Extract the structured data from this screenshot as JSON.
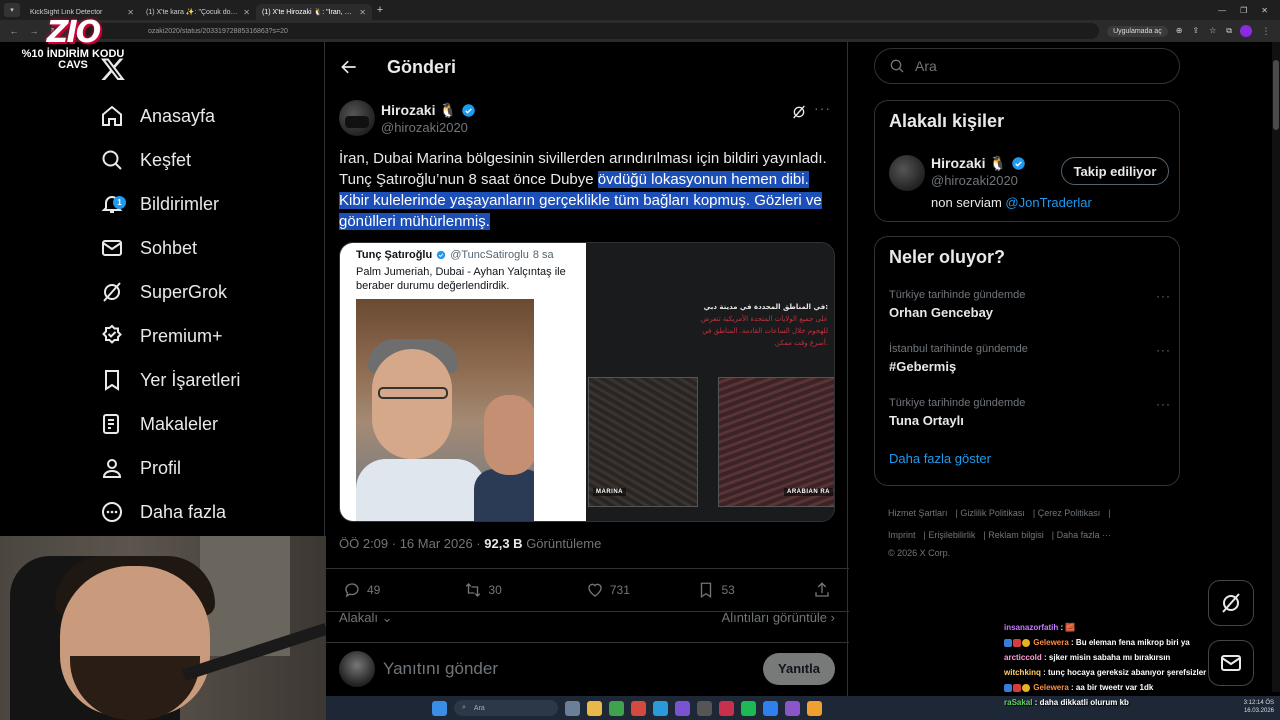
{
  "browser": {
    "tabs": [
      {
        "label": "KickSight Link Detector",
        "active": false
      },
      {
        "label": "(1) X'te kara ✨: \"Çocuk doğuran",
        "active": false
      },
      {
        "label": "(1) X'te Hirozaki 🐧: \"İran, Dub",
        "active": true
      }
    ],
    "url": "ozaki2020/status/20331972885316863?s=20",
    "open_in_app": "Uygulamada aç"
  },
  "promo": {
    "logo": "ZIO",
    "line1": "%10 İNDİRİM KODU",
    "line2": "CAVS"
  },
  "nav": {
    "items": [
      {
        "label": "Anasayfa",
        "icon": "home-icon"
      },
      {
        "label": "Keşfet",
        "icon": "search-icon"
      },
      {
        "label": "Bildirimler",
        "icon": "bell-icon",
        "badge": "1"
      },
      {
        "label": "Sohbet",
        "icon": "mail-icon"
      },
      {
        "label": "SuperGrok",
        "icon": "grok-icon"
      },
      {
        "label": "Premium+",
        "icon": "premium-icon"
      },
      {
        "label": "Yer İşaretleri",
        "icon": "bookmark-icon"
      },
      {
        "label": "Makaleler",
        "icon": "article-icon"
      },
      {
        "label": "Profil",
        "icon": "profile-icon"
      },
      {
        "label": "Daha fazla",
        "icon": "more-circle-icon"
      }
    ]
  },
  "post": {
    "header_title": "Gönderi",
    "author_name": "Hirozaki 🐧",
    "author_handle": "@hirozaki2020",
    "text_plain": "İran, Dubai Marina bölgesinin sivillerden arındırılması için bildiri yayınladı. Tunç Şatıroğlu’nun 8 saat önce Dubye ",
    "text_highlighted": "övdüğü lokasyonun hemen dibi. Kibir kulelerinde yaşayanların gerçeklikle tüm bağları kopmuş. Gözleri ve gönülleri mühürlenmiş.",
    "quote": {
      "name": "Tunç Şatıroğlu",
      "handle": "@TuncSatiroglu",
      "time": "8 sa",
      "text": "Palm Jumeriah, Dubai - Ayhan Yalçıntaş ile beraber durumu değerlendirdik.",
      "arabic_title": "في المناطق المحددة في مدينة دبي:",
      "arabic_body": "على جميع الولايات المتحدة الأمريكية تتعرض للهجوم خلال الساعات القادمة. المناطق في أسرع وقت ممكن.",
      "map_label_1": "MARINA",
      "map_label_2": "ARABIAN RA"
    },
    "time": "ÖÖ 2:09 · 16 Mar 2026",
    "views": "92,3 B",
    "views_label": "Görüntüleme",
    "replies": "49",
    "reposts": "30",
    "likes": "731",
    "bookmarks": "53",
    "related": "Alakalı",
    "view_quotes": "Alıntıları görüntüle",
    "reply_placeholder": "Yanıtını gönder",
    "reply_button": "Yanıtla"
  },
  "sidebar": {
    "search_placeholder": "Ara",
    "related_title": "Alakalı kişiler",
    "person": {
      "name": "Hirozaki 🐧",
      "handle": "@hirozaki2020",
      "bio": "non serviam ",
      "bio_mention": "@JonTraderlar",
      "follow": "Takip ediliyor"
    },
    "trends_title": "Neler oluyor?",
    "trends": [
      {
        "context": "Türkiye tarihinde gündemde",
        "title": "Orhan Gencebay"
      },
      {
        "context": "İstanbul tarihinde gündemde",
        "title": "#Gebermiş"
      },
      {
        "context": "Türkiye tarihinde gündemde",
        "title": "Tuna Ortaylı"
      }
    ],
    "show_more": "Daha fazla göster",
    "footer": [
      "Hizmet Şartları",
      "Gizlilik Politikası",
      "Çerez Politikası",
      "Imprint",
      "Erişilebilirlik",
      "Reklam bilgisi",
      "Daha fazla ···",
      "© 2026 X Corp."
    ]
  },
  "chat": [
    {
      "user": "insanazorfatih",
      "msg": " 🧱"
    },
    {
      "user": "Gelewera",
      "msg": " Bu eleman fena mikrop biri ya"
    },
    {
      "user": "arcticcold",
      "msg": " sjker misin sabaha mı bırakırsın"
    },
    {
      "user": "witchkinq",
      "msg": " tunç hocaya gereksiz abanıyor şerefsizler"
    },
    {
      "user": "Gelewera",
      "msg": " aa bir tweetr var 1dk"
    },
    {
      "user": "raSakal",
      "msg": " daha dikkatli olurum kb"
    }
  ],
  "taskbar": {
    "search": "Ara",
    "time": "3:12:14 ÖS",
    "date": "16.03.2026"
  },
  "colors": {
    "accent": "#1d9bf0",
    "background": "#000000",
    "border": "#2f3336",
    "muted": "#71767b",
    "highlight": "#1d4fb8"
  }
}
